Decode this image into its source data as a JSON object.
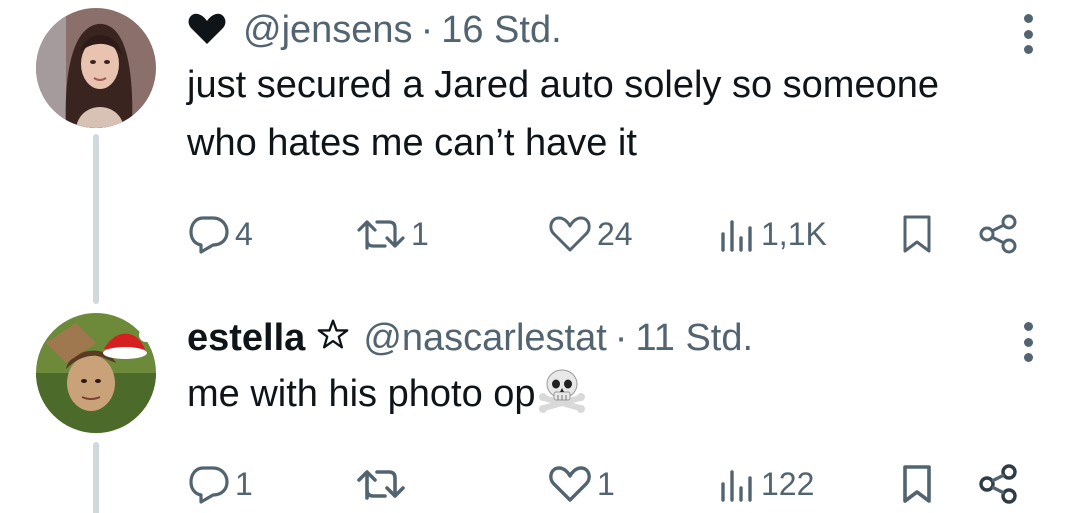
{
  "tweets": [
    {
      "badge": "heart",
      "display_name": "",
      "handle": "@jensens",
      "separator": "·",
      "time": "16 Std.",
      "text": "just secured a Jared auto solely so someone who hates me can’t have it",
      "stats": {
        "replies": "4",
        "retweets": "1",
        "likes": "24",
        "views": "1,1K"
      }
    },
    {
      "badge": "star",
      "display_name": "estella",
      "handle": "@nascarlestat",
      "separator": "·",
      "time": "11 Std.",
      "text": "me with his photo op",
      "emoji": "skull-and-crossbones",
      "stats": {
        "replies": "1",
        "retweets": "",
        "likes": "1",
        "views": "122"
      }
    }
  ],
  "colors": {
    "text": "#0f1419",
    "muted": "#536471",
    "thread_line": "#cfd9de",
    "background": "#ffffff"
  },
  "icons": [
    "reply-icon",
    "retweet-icon",
    "like-icon",
    "views-icon",
    "bookmark-icon",
    "share-icon",
    "more-icon",
    "heart-badge-icon",
    "star-badge-icon",
    "skull-emoji-icon"
  ]
}
